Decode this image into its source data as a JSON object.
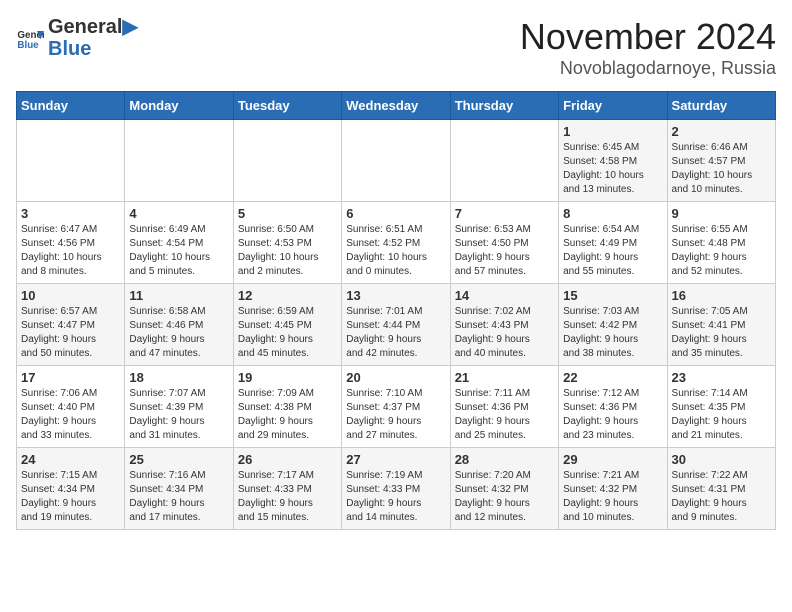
{
  "header": {
    "logo_general": "General",
    "logo_blue": "Blue",
    "month": "November 2024",
    "location": "Novoblagodarnoye, Russia"
  },
  "weekdays": [
    "Sunday",
    "Monday",
    "Tuesday",
    "Wednesday",
    "Thursday",
    "Friday",
    "Saturday"
  ],
  "weeks": [
    [
      {
        "day": "",
        "info": ""
      },
      {
        "day": "",
        "info": ""
      },
      {
        "day": "",
        "info": ""
      },
      {
        "day": "",
        "info": ""
      },
      {
        "day": "",
        "info": ""
      },
      {
        "day": "1",
        "info": "Sunrise: 6:45 AM\nSunset: 4:58 PM\nDaylight: 10 hours\nand 13 minutes."
      },
      {
        "day": "2",
        "info": "Sunrise: 6:46 AM\nSunset: 4:57 PM\nDaylight: 10 hours\nand 10 minutes."
      }
    ],
    [
      {
        "day": "3",
        "info": "Sunrise: 6:47 AM\nSunset: 4:56 PM\nDaylight: 10 hours\nand 8 minutes."
      },
      {
        "day": "4",
        "info": "Sunrise: 6:49 AM\nSunset: 4:54 PM\nDaylight: 10 hours\nand 5 minutes."
      },
      {
        "day": "5",
        "info": "Sunrise: 6:50 AM\nSunset: 4:53 PM\nDaylight: 10 hours\nand 2 minutes."
      },
      {
        "day": "6",
        "info": "Sunrise: 6:51 AM\nSunset: 4:52 PM\nDaylight: 10 hours\nand 0 minutes."
      },
      {
        "day": "7",
        "info": "Sunrise: 6:53 AM\nSunset: 4:50 PM\nDaylight: 9 hours\nand 57 minutes."
      },
      {
        "day": "8",
        "info": "Sunrise: 6:54 AM\nSunset: 4:49 PM\nDaylight: 9 hours\nand 55 minutes."
      },
      {
        "day": "9",
        "info": "Sunrise: 6:55 AM\nSunset: 4:48 PM\nDaylight: 9 hours\nand 52 minutes."
      }
    ],
    [
      {
        "day": "10",
        "info": "Sunrise: 6:57 AM\nSunset: 4:47 PM\nDaylight: 9 hours\nand 50 minutes."
      },
      {
        "day": "11",
        "info": "Sunrise: 6:58 AM\nSunset: 4:46 PM\nDaylight: 9 hours\nand 47 minutes."
      },
      {
        "day": "12",
        "info": "Sunrise: 6:59 AM\nSunset: 4:45 PM\nDaylight: 9 hours\nand 45 minutes."
      },
      {
        "day": "13",
        "info": "Sunrise: 7:01 AM\nSunset: 4:44 PM\nDaylight: 9 hours\nand 42 minutes."
      },
      {
        "day": "14",
        "info": "Sunrise: 7:02 AM\nSunset: 4:43 PM\nDaylight: 9 hours\nand 40 minutes."
      },
      {
        "day": "15",
        "info": "Sunrise: 7:03 AM\nSunset: 4:42 PM\nDaylight: 9 hours\nand 38 minutes."
      },
      {
        "day": "16",
        "info": "Sunrise: 7:05 AM\nSunset: 4:41 PM\nDaylight: 9 hours\nand 35 minutes."
      }
    ],
    [
      {
        "day": "17",
        "info": "Sunrise: 7:06 AM\nSunset: 4:40 PM\nDaylight: 9 hours\nand 33 minutes."
      },
      {
        "day": "18",
        "info": "Sunrise: 7:07 AM\nSunset: 4:39 PM\nDaylight: 9 hours\nand 31 minutes."
      },
      {
        "day": "19",
        "info": "Sunrise: 7:09 AM\nSunset: 4:38 PM\nDaylight: 9 hours\nand 29 minutes."
      },
      {
        "day": "20",
        "info": "Sunrise: 7:10 AM\nSunset: 4:37 PM\nDaylight: 9 hours\nand 27 minutes."
      },
      {
        "day": "21",
        "info": "Sunrise: 7:11 AM\nSunset: 4:36 PM\nDaylight: 9 hours\nand 25 minutes."
      },
      {
        "day": "22",
        "info": "Sunrise: 7:12 AM\nSunset: 4:36 PM\nDaylight: 9 hours\nand 23 minutes."
      },
      {
        "day": "23",
        "info": "Sunrise: 7:14 AM\nSunset: 4:35 PM\nDaylight: 9 hours\nand 21 minutes."
      }
    ],
    [
      {
        "day": "24",
        "info": "Sunrise: 7:15 AM\nSunset: 4:34 PM\nDaylight: 9 hours\nand 19 minutes."
      },
      {
        "day": "25",
        "info": "Sunrise: 7:16 AM\nSunset: 4:34 PM\nDaylight: 9 hours\nand 17 minutes."
      },
      {
        "day": "26",
        "info": "Sunrise: 7:17 AM\nSunset: 4:33 PM\nDaylight: 9 hours\nand 15 minutes."
      },
      {
        "day": "27",
        "info": "Sunrise: 7:19 AM\nSunset: 4:33 PM\nDaylight: 9 hours\nand 14 minutes."
      },
      {
        "day": "28",
        "info": "Sunrise: 7:20 AM\nSunset: 4:32 PM\nDaylight: 9 hours\nand 12 minutes."
      },
      {
        "day": "29",
        "info": "Sunrise: 7:21 AM\nSunset: 4:32 PM\nDaylight: 9 hours\nand 10 minutes."
      },
      {
        "day": "30",
        "info": "Sunrise: 7:22 AM\nSunset: 4:31 PM\nDaylight: 9 hours\nand 9 minutes."
      }
    ]
  ]
}
